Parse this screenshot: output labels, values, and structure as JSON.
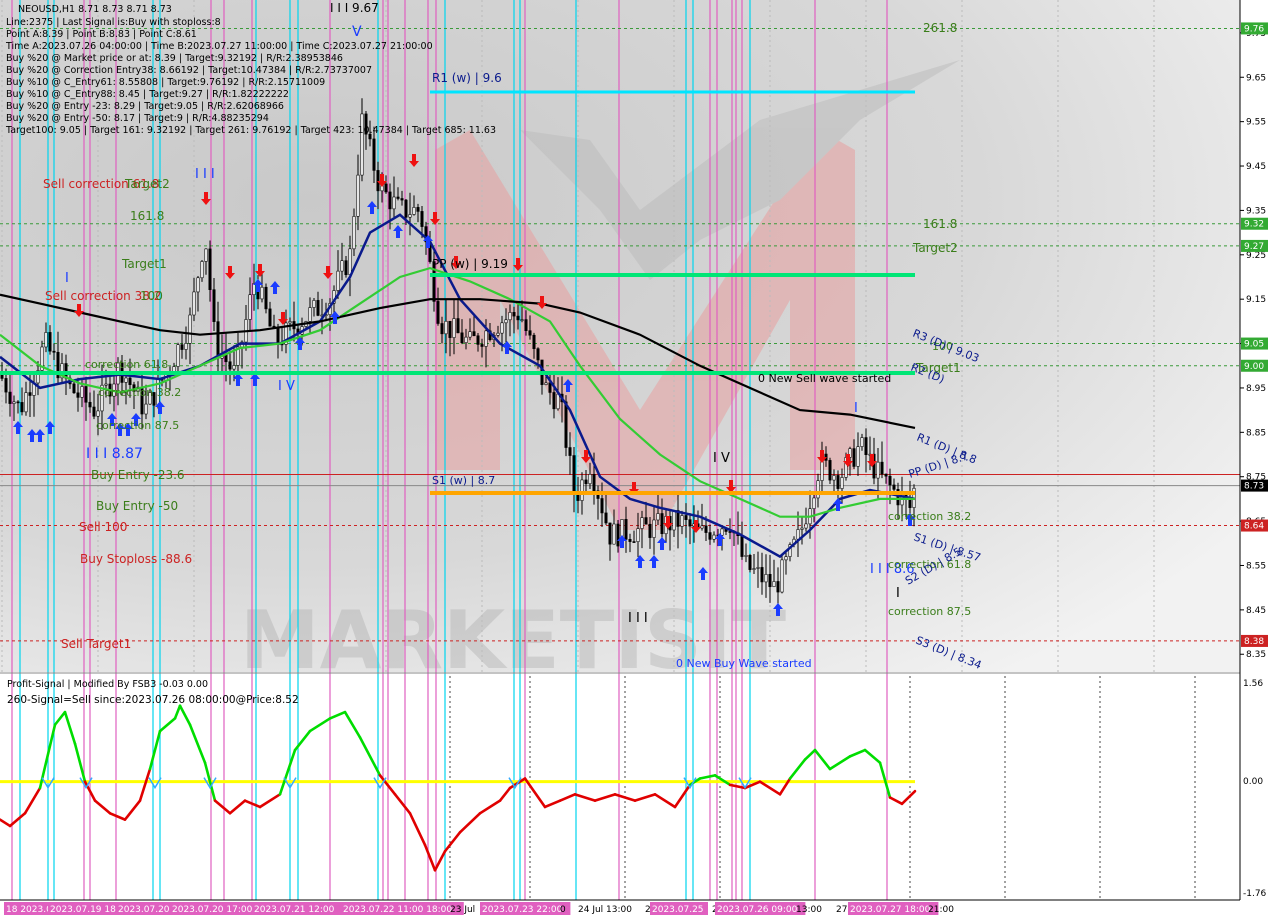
{
  "colors": {
    "background": "#d8d8d8",
    "bull_wick": "#000000",
    "signal_red": "#e00000",
    "signal_green": "#00dd00",
    "zero_line": "#ffff00",
    "pivot_cyan": "#00e5ff",
    "pivot_green": "#00e676",
    "support_orange": "#ffa500",
    "ma_blue": "#0a1a8c",
    "ma_green": "#33cc33",
    "ma_black": "#000000",
    "buy_arrow": "#1a3cff",
    "sell_arrow": "#ee1111",
    "watermark": "#e8a0a0"
  },
  "header": {
    "symbol_line": "NEOUSD,H1  8.71 8.73 8.71 8.73",
    "info_lines": [
      "Line:2375 | Last Signal is:Buy with stoploss:8",
      "Point A:8.39 | Point B:8.83 | Point C:8.61",
      "Time A:2023.07.26 04:00:00 | Time B:2023.07.27 11:00:00 | Time C:2023.07.27 21:00:00",
      "Buy %20 @ Market price or at: 8.39 | Target:9.32192 | R/R:2.38953846",
      "Buy %20 @ Correction Entry38: 8.66192 | Target:10.47384 | R/R:2.73737007",
      "Buy %10 @ C_Entry61: 8.55808 | Target:9.76192 | R/R:2.15711009",
      "Buy %10 @ C_Entry88: 8.45 | Target:9.27 | R/R:1.82222222",
      "Buy %20 @ Entry -23: 8.29 | Target:9.05 | R/R:2.62068966",
      "Buy %20 @ Entry -50: 8.17 | Target:9 | R/R:4.88235294",
      "Target100: 9.05 | Target 161: 9.32192 | Target 261: 9.76192 | Target 423: 10.47384 | Target 685: 11.63"
    ]
  },
  "y_axis": {
    "ticks": [
      "9.75",
      "9.65",
      "9.55",
      "9.45",
      "9.35",
      "9.25",
      "9.15",
      "9.05",
      "8.95",
      "8.85",
      "8.75",
      "8.65",
      "8.55",
      "8.45",
      "8.35"
    ],
    "badges": [
      {
        "value": "9.76",
        "color": "#33aa33"
      },
      {
        "value": "9.32",
        "color": "#33aa33"
      },
      {
        "value": "9.27",
        "color": "#33aa33"
      },
      {
        "value": "9.05",
        "color": "#33aa33"
      },
      {
        "value": "9.00",
        "color": "#33aa33"
      },
      {
        "value": "8.73",
        "color": "#000000"
      },
      {
        "value": "8.64",
        "color": "#cc2222"
      },
      {
        "value": "8.38",
        "color": "#cc2222"
      }
    ]
  },
  "x_axis": {
    "labels": [
      {
        "text": "18 2023.07.",
        "hl": true
      },
      {
        "text": "2023.07.19 18:00",
        "hl": true
      },
      {
        "text": "2023.07.20",
        "hl": true
      },
      {
        "text": "2023.07.20 17:00",
        "hl": true
      },
      {
        "text": "2023.07.21 12:00",
        "hl": true
      },
      {
        "text": "2023.07.22 11:00 18:00",
        "hl": true
      },
      {
        "text": "23 Jul",
        "hl": false
      },
      {
        "text": "2023.07.23 22:00",
        "hl": true
      },
      {
        "text": "0",
        "hl": false
      },
      {
        "text": "24 Jul 13:00",
        "hl": false
      },
      {
        "text": "2",
        "hl": false
      },
      {
        "text": "2023.07.25",
        "hl": true
      },
      {
        "text": "2",
        "hl": false
      },
      {
        "text": "2023.07.26 09:00",
        "hl": true
      },
      {
        "text": "13:00",
        "hl": false
      },
      {
        "text": "27",
        "hl": false
      },
      {
        "text": "2023.07.27 18:00",
        "hl": true
      },
      {
        "text": "21:00",
        "hl": false
      }
    ]
  },
  "labels": {
    "v_top": "I I I 9.67",
    "v_mark": "V",
    "r1w": "R1 (w) | 9.6",
    "ppw": "PP (w) | 9.19",
    "s1w": "S1 (w) | 8.7",
    "t2618": "261.8",
    "t1618_right": "161.8",
    "target2_right": "Target2",
    "sell_corr_618": "Sell correction 61.8",
    "target2_left": "Target2",
    "t1618_left": "161.8",
    "target1_left": "Target1",
    "sell_corr_382": "Sell correction 38.2",
    "l100": "100",
    "corr_618_left": "correction 61.8",
    "corr_382_left": "correction 38.2",
    "corr_875_left": "correction 87.5",
    "iii_887": "I I I 8.87",
    "buy_entry_23": "Buy Entry -23.6",
    "buy_entry_50": "Buy Entry -50",
    "sell_100": "Sell 100",
    "buy_stoploss": "Buy Stoploss -88.6",
    "sell_target1": "Sell Target1",
    "iii_left_top": "I I I",
    "i_left": "I",
    "iv_left": "I V",
    "iv_mid": "I V",
    "iii_bottom": "I I I",
    "new_sell": "0 New Sell wave started",
    "new_buy": "0 New Buy Wave started",
    "r3d": "R3 (D) | 9.03",
    "l100_right": "100",
    "target1_right": "Target1",
    "r2d": "R2 (D)",
    "r1d": "R1 (D) | 8.8",
    "ppd": "PP (D) | 8.7",
    "corr_382_right": "correction 38.2",
    "s1d": "S1 (D) | 8.57",
    "iii_right": "I I I 8.6",
    "corr_618_right": "correction 61.8",
    "s2d": "S2 (D) | 8.5",
    "corr_875_right": "correction 87.5",
    "s3d": "S3 (D) | 8.34",
    "i_right": "I",
    "i_mid": "I",
    "watermark_text": "MARKETISIT"
  },
  "indicator": {
    "title": "Profit-Signal | Modified By FSB3 -0.03 0.00",
    "signal_text": "260-Signal=Sell since:2023.07.26 08:00:00@Price:8.52",
    "ticks": [
      "1.56",
      "0.00",
      "-1.76"
    ]
  },
  "chart_data": {
    "type": "line",
    "title": "NEOUSD,H1  8.71 8.73 8.71 8.73",
    "xlabel": "",
    "ylabel": "",
    "ylim": [
      8.3,
      9.8
    ],
    "grid": true,
    "price_key_points": [
      [
        0,
        8.98
      ],
      [
        20,
        8.9
      ],
      [
        45,
        9.05
      ],
      [
        70,
        8.95
      ],
      [
        95,
        8.9
      ],
      [
        120,
        9.0
      ],
      [
        145,
        8.9
      ],
      [
        170,
        9.0
      ],
      [
        190,
        9.1
      ],
      [
        205,
        9.3
      ],
      [
        215,
        9.05
      ],
      [
        235,
        8.98
      ],
      [
        255,
        9.2
      ],
      [
        275,
        9.05
      ],
      [
        300,
        9.1
      ],
      [
        330,
        9.15
      ],
      [
        350,
        9.25
      ],
      [
        362,
        9.55
      ],
      [
        380,
        9.4
      ],
      [
        400,
        9.35
      ],
      [
        420,
        9.35
      ],
      [
        440,
        9.1
      ],
      [
        470,
        9.05
      ],
      [
        500,
        9.1
      ],
      [
        520,
        9.12
      ],
      [
        545,
        8.95
      ],
      [
        560,
        8.92
      ],
      [
        575,
        8.7
      ],
      [
        590,
        8.78
      ],
      [
        610,
        8.62
      ],
      [
        640,
        8.63
      ],
      [
        680,
        8.65
      ],
      [
        700,
        8.62
      ],
      [
        730,
        8.65
      ],
      [
        745,
        8.55
      ],
      [
        775,
        8.5
      ],
      [
        800,
        8.62
      ],
      [
        820,
        8.78
      ],
      [
        840,
        8.75
      ],
      [
        860,
        8.82
      ],
      [
        880,
        8.75
      ],
      [
        910,
        8.68
      ],
      [
        915,
        8.73
      ]
    ],
    "series": [
      {
        "name": "MA fast (blue)",
        "points": [
          [
            0,
            9.02
          ],
          [
            40,
            8.95
          ],
          [
            80,
            8.97
          ],
          [
            120,
            8.98
          ],
          [
            160,
            8.97
          ],
          [
            200,
            9.0
          ],
          [
            240,
            9.05
          ],
          [
            280,
            9.05
          ],
          [
            320,
            9.1
          ],
          [
            350,
            9.2
          ],
          [
            370,
            9.3
          ],
          [
            400,
            9.34
          ],
          [
            430,
            9.28
          ],
          [
            460,
            9.15
          ],
          [
            500,
            9.05
          ],
          [
            540,
            9.0
          ],
          [
            570,
            8.9
          ],
          [
            600,
            8.75
          ],
          [
            630,
            8.7
          ],
          [
            660,
            8.68
          ],
          [
            700,
            8.66
          ],
          [
            740,
            8.62
          ],
          [
            780,
            8.57
          ],
          [
            810,
            8.63
          ],
          [
            840,
            8.7
          ],
          [
            870,
            8.72
          ],
          [
            915,
            8.7
          ]
        ]
      },
      {
        "name": "MA mid (green)",
        "points": [
          [
            0,
            9.07
          ],
          [
            40,
            9.0
          ],
          [
            80,
            8.96
          ],
          [
            120,
            8.94
          ],
          [
            160,
            8.96
          ],
          [
            200,
            9.0
          ],
          [
            240,
            9.04
          ],
          [
            280,
            9.05
          ],
          [
            320,
            9.08
          ],
          [
            360,
            9.14
          ],
          [
            400,
            9.2
          ],
          [
            430,
            9.22
          ],
          [
            470,
            9.19
          ],
          [
            510,
            9.15
          ],
          [
            550,
            9.1
          ],
          [
            580,
            9.0
          ],
          [
            620,
            8.88
          ],
          [
            660,
            8.8
          ],
          [
            700,
            8.74
          ],
          [
            740,
            8.7
          ],
          [
            780,
            8.66
          ],
          [
            810,
            8.66
          ],
          [
            840,
            8.68
          ],
          [
            880,
            8.7
          ],
          [
            915,
            8.7
          ]
        ]
      },
      {
        "name": "MA slow (black)",
        "points": [
          [
            0,
            9.16
          ],
          [
            40,
            9.14
          ],
          [
            80,
            9.12
          ],
          [
            120,
            9.1
          ],
          [
            160,
            9.08
          ],
          [
            200,
            9.07
          ],
          [
            260,
            9.08
          ],
          [
            320,
            9.1
          ],
          [
            380,
            9.13
          ],
          [
            430,
            9.15
          ],
          [
            480,
            9.15
          ],
          [
            540,
            9.14
          ],
          [
            580,
            9.12
          ],
          [
            640,
            9.07
          ],
          [
            700,
            9.0
          ],
          [
            760,
            8.94
          ],
          [
            800,
            8.9
          ],
          [
            850,
            8.89
          ],
          [
            915,
            8.86
          ]
        ]
      }
    ],
    "oscillator": {
      "ylim": [
        -1.76,
        1.56
      ],
      "points": [
        [
          0,
          -0.6
        ],
        [
          10,
          -0.7
        ],
        [
          25,
          -0.5
        ],
        [
          40,
          -0.1
        ],
        [
          55,
          0.9
        ],
        [
          65,
          1.1
        ],
        [
          75,
          0.6
        ],
        [
          85,
          0.0
        ],
        [
          95,
          -0.3
        ],
        [
          110,
          -0.5
        ],
        [
          125,
          -0.6
        ],
        [
          140,
          -0.3
        ],
        [
          150,
          0.2
        ],
        [
          160,
          0.8
        ],
        [
          175,
          1.0
        ],
        [
          180,
          1.2
        ],
        [
          190,
          0.9
        ],
        [
          205,
          0.3
        ],
        [
          215,
          -0.3
        ],
        [
          230,
          -0.5
        ],
        [
          245,
          -0.3
        ],
        [
          260,
          -0.4
        ],
        [
          280,
          -0.2
        ],
        [
          295,
          0.5
        ],
        [
          310,
          0.8
        ],
        [
          330,
          1.0
        ],
        [
          345,
          1.1
        ],
        [
          360,
          0.7
        ],
        [
          380,
          0.1
        ],
        [
          395,
          -0.2
        ],
        [
          410,
          -0.5
        ],
        [
          425,
          -1.0
        ],
        [
          435,
          -1.4
        ],
        [
          445,
          -1.1
        ],
        [
          460,
          -0.8
        ],
        [
          480,
          -0.5
        ],
        [
          500,
          -0.3
        ],
        [
          510,
          -0.1
        ],
        [
          525,
          0.05
        ],
        [
          545,
          -0.4
        ],
        [
          560,
          -0.3
        ],
        [
          575,
          -0.2
        ],
        [
          595,
          -0.3
        ],
        [
          615,
          -0.2
        ],
        [
          635,
          -0.3
        ],
        [
          655,
          -0.2
        ],
        [
          675,
          -0.4
        ],
        [
          690,
          -0.05
        ],
        [
          700,
          0.05
        ],
        [
          715,
          0.1
        ],
        [
          730,
          -0.05
        ],
        [
          745,
          -0.1
        ],
        [
          760,
          0.0
        ],
        [
          780,
          -0.2
        ],
        [
          790,
          0.05
        ],
        [
          805,
          0.35
        ],
        [
          815,
          0.5
        ],
        [
          830,
          0.2
        ],
        [
          850,
          0.4
        ],
        [
          865,
          0.5
        ],
        [
          880,
          0.3
        ],
        [
          890,
          -0.25
        ],
        [
          902,
          -0.35
        ],
        [
          915,
          -0.15
        ]
      ]
    }
  }
}
